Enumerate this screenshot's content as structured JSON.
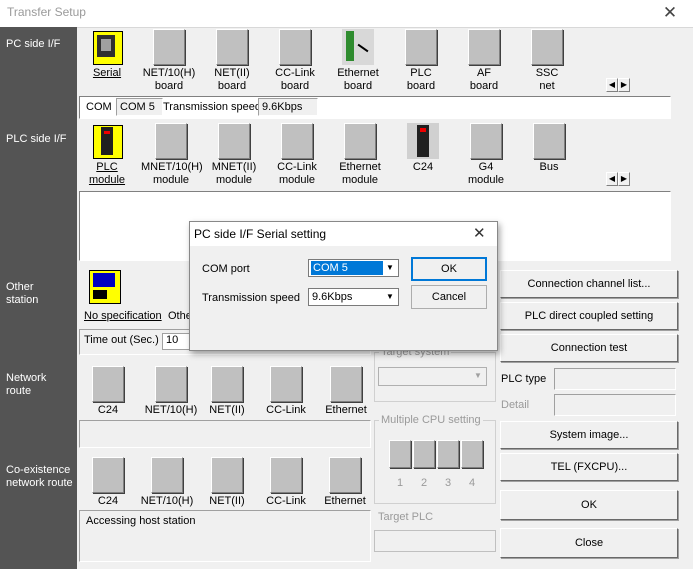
{
  "window": {
    "title": "Transfer Setup",
    "close": "✕"
  },
  "pc_side": {
    "label": "PC side I/F",
    "devices": [
      "Serial",
      "NET/10(H)\nboard",
      "NET(II)\nboard",
      "CC-Link\nboard",
      "Ethernet\nboard",
      "PLC\nboard",
      "AF\nboard",
      "SSC\nnet"
    ],
    "com_label": "COM",
    "com_value": "COM 5",
    "speed_label": "Transmission speed",
    "speed_value": "9.6Kbps"
  },
  "plc_side": {
    "label": "PLC side I/F",
    "devices": [
      "PLC\nmodule",
      "MNET/10(H)\nmodule",
      "MNET(II)\nmodule",
      "CC-Link\nmodule",
      "Ethernet\nmodule",
      "C24",
      "G4\nmodule",
      "Bus"
    ]
  },
  "other_station": {
    "label": "Other\nstation",
    "device": "No specification",
    "other": "Othe",
    "timeout_label": "Time out (Sec.)",
    "timeout_value": "10"
  },
  "network_route": {
    "label": "Network\nroute",
    "devices": [
      "C24",
      "NET/10(H)",
      "NET(II)",
      "CC-Link",
      "Ethernet"
    ]
  },
  "coexistence": {
    "label": "Co-existence\nnetwork route",
    "devices": [
      "C24",
      "NET/10(H)",
      "NET(II)",
      "CC-Link",
      "Ethernet"
    ],
    "status": "Accessing host station"
  },
  "target_system": {
    "label": "Target system"
  },
  "multiple_cpu": {
    "label": "Multiple CPU setting",
    "slots": [
      "1",
      "2",
      "3",
      "4"
    ]
  },
  "target_plc": {
    "label": "Target PLC"
  },
  "right_buttons": {
    "connection_channel": "Connection  channel  list...",
    "plc_direct": "PLC direct coupled setting",
    "connection_test": "Connection test",
    "plc_type_label": "PLC type",
    "detail_label": "Detail",
    "system_image": "System   image...",
    "tel": "TEL (FXCPU)...",
    "ok": "OK",
    "close": "Close"
  },
  "dialog": {
    "title": "PC side I/F  Serial setting",
    "close": "✕",
    "com_port_label": "COM port",
    "com_port_value": "COM 5",
    "speed_label": "Transmission speed",
    "speed_value": "9.6Kbps",
    "ok": "OK",
    "cancel": "Cancel"
  },
  "colors": {
    "left_column": "#545454",
    "selected_combo": "#0078d7"
  }
}
